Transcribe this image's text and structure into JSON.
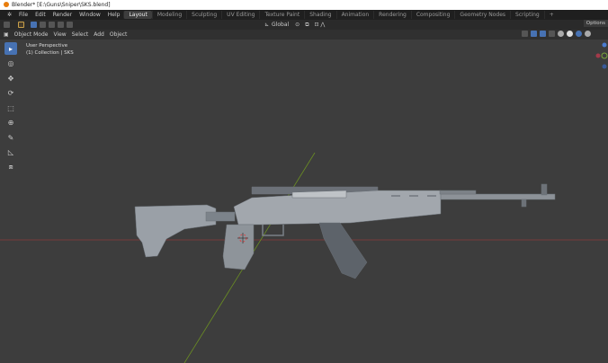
{
  "window": {
    "title": "Blender* [E:\\Guns\\Sniper\\SKS.blend]"
  },
  "menu": [
    "File",
    "Edit",
    "Render",
    "Window",
    "Help"
  ],
  "workspaces": [
    {
      "label": "Layout",
      "active": true
    },
    {
      "label": "Modeling"
    },
    {
      "label": "Sculpting"
    },
    {
      "label": "UV Editing"
    },
    {
      "label": "Texture Paint"
    },
    {
      "label": "Shading"
    },
    {
      "label": "Animation"
    },
    {
      "label": "Rendering"
    },
    {
      "label": "Compositing"
    },
    {
      "label": "Geometry Nodes"
    },
    {
      "label": "Scripting"
    },
    {
      "label": "+"
    }
  ],
  "tool_header": {
    "orientation": "Global",
    "options": "Options"
  },
  "viewport_header": {
    "mode": "Object Mode",
    "menus": [
      "View",
      "Select",
      "Add",
      "Object"
    ]
  },
  "overlay_text": {
    "perspective": "User Perspective",
    "collection": "(1) Collection | SKS"
  },
  "toolbar": [
    {
      "icon": "select-box-icon",
      "active": true
    },
    {
      "icon": "cursor-icon"
    },
    {
      "icon": "move-icon"
    },
    {
      "icon": "rotate-icon"
    },
    {
      "icon": "scale-icon"
    },
    {
      "icon": "transform-icon"
    },
    {
      "icon": "annotate-icon"
    },
    {
      "icon": "measure-icon"
    },
    {
      "icon": "add-cube-icon"
    }
  ],
  "colors": {
    "accent": "#4772b3",
    "x_axis": "#8b3a3a",
    "y_axis": "#6b8e23",
    "viewport": "#3d3d3d"
  }
}
